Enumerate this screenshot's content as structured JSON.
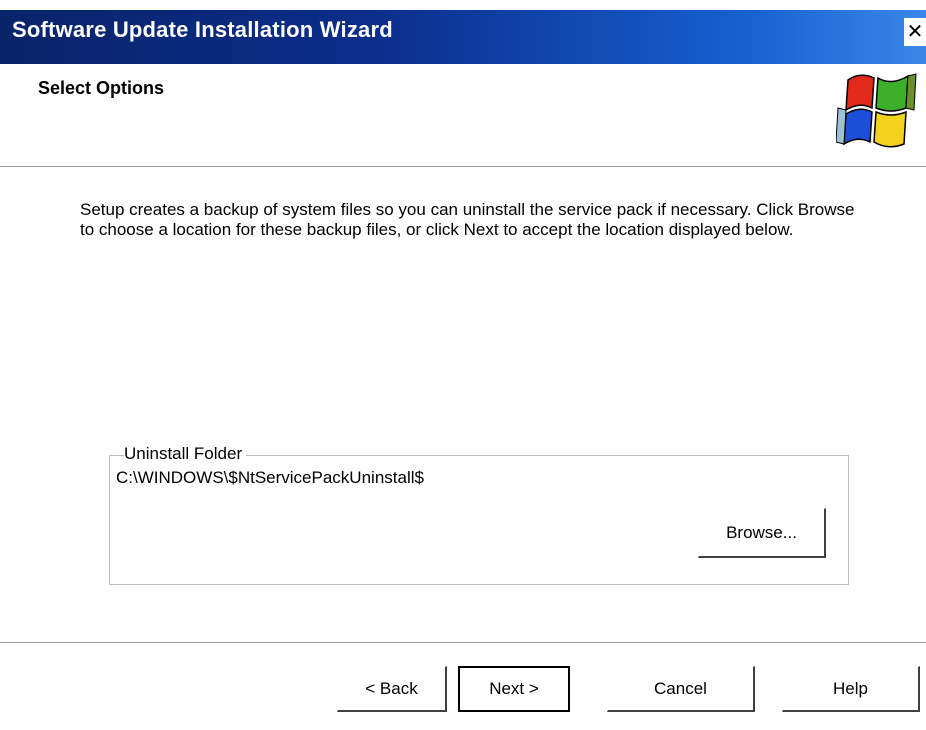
{
  "window": {
    "title": "Software Update Installation Wizard",
    "close_glyph": "✕"
  },
  "header": {
    "title": "Select Options",
    "logo_icon": "windows-flag-icon"
  },
  "content": {
    "description": "Setup creates a backup of system files so you can uninstall the service pack if necessary.  Click Browse to choose a location for these backup files, or click Next to accept the location displayed below.",
    "group_label": "Uninstall Folder",
    "folder_path": "C:\\WINDOWS\\$NtServicePackUninstall$",
    "browse_label": "Browse..."
  },
  "footer": {
    "back_label": "< Back",
    "next_label": "Next >",
    "cancel_label": "Cancel",
    "help_label": "Help"
  },
  "colors": {
    "titlebar_start": "#0a246a",
    "titlebar_end": "#3a86e8",
    "flag_red": "#e02a1a",
    "flag_green": "#3cb028",
    "flag_blue": "#1e4fd8",
    "flag_yellow": "#f2d21c"
  }
}
